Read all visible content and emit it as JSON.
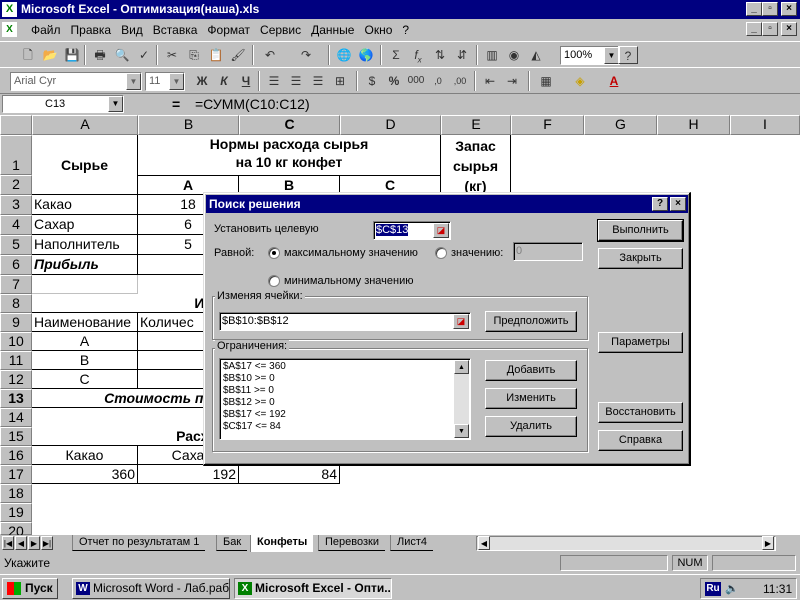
{
  "window": {
    "title": "Microsoft Excel - Оптимизация(наша).xls",
    "app_icon": "excel-icon"
  },
  "menu": [
    "Файл",
    "Правка",
    "Вид",
    "Вставка",
    "Формат",
    "Сервис",
    "Данные",
    "Окно",
    "?"
  ],
  "toolbar": {
    "zoom": "100%",
    "font_name": "Arial Cyr",
    "font_size": "11",
    "bold": "Ж",
    "italic": "К",
    "underline": "Ч",
    "percent": "%",
    "sigma": "Σ",
    "fx": "f",
    "fx_sub": "x"
  },
  "formula_bar": {
    "name_box": "C13",
    "equals": "=",
    "formula": "=СУММ(C10:C12)"
  },
  "columns": [
    "A",
    "B",
    "C",
    "D",
    "E",
    "F",
    "G",
    "H",
    "I"
  ],
  "rows": [
    "1",
    "2",
    "3",
    "4",
    "5",
    "6",
    "7",
    "8",
    "9",
    "10",
    "11",
    "12",
    "13",
    "14",
    "15",
    "16",
    "17",
    "18",
    "19",
    "20"
  ],
  "cells": {
    "a1": "Сырье",
    "b1_l1": "Нормы расхода сырья",
    "b1_l2": "на 10 кг конфет",
    "e1_l1": "Запас",
    "e1_l2": "сырья",
    "e1_l3": "(кг)",
    "b2": "A",
    "c2": "B",
    "d2": "C",
    "a3": "Какао",
    "b3": "18",
    "a4": "Сахар",
    "b4": "6",
    "a5": "Наполнитель",
    "b5": "5",
    "a6": "Прибыль",
    "b8": "Издел",
    "a9": "Наименование",
    "b9": "Количес",
    "a10": "A",
    "a11": "B",
    "a12": "C",
    "a13": "Стоимость проду",
    "b15": "Расход с",
    "a16": "Какао",
    "b16": "Саха",
    "a17": "360",
    "b17": "192",
    "c17": "84"
  },
  "sheet_tabs": [
    "Отчет по результатам 1",
    "Бак",
    "Конфеты",
    "Перевозки",
    "Лист4"
  ],
  "active_sheet": "Конфеты",
  "status": {
    "text": "Укажите",
    "num": "NUM"
  },
  "taskbar": {
    "start": "Пуск",
    "tasks": [
      {
        "label": "Microsoft Word - Лаб.раб...",
        "icon": "W",
        "active": false
      },
      {
        "label": "Microsoft Excel - Опти...",
        "icon": "X",
        "active": true
      }
    ],
    "lang": "Ru",
    "clock": "11:31"
  },
  "dialog": {
    "title": "Поиск решения",
    "help": "?",
    "target_label": "Установить целевую",
    "target_value": "$C$13",
    "equal_label": "Равной:",
    "opt_max": "максимальному значению",
    "opt_value": "значению:",
    "value_field": "0",
    "opt_min": "минимальному значению",
    "changing_label": "Изменяя ячейки:",
    "changing_value": "$B$10:$B$12",
    "constraints_label": "Ограничения:",
    "constraints": [
      "$A$17 <= 360",
      "$B$10 >= 0",
      "$B$11 >= 0",
      "$B$12 >= 0",
      "$B$17 <= 192",
      "$C$17 <= 84"
    ],
    "btn_guess": "Предположить",
    "btn_run": "Выполнить",
    "btn_close": "Закрыть",
    "btn_params": "Параметры",
    "btn_add": "Добавить",
    "btn_change": "Изменить",
    "btn_delete": "Удалить",
    "btn_reset": "Восстановить",
    "btn_help": "Справка",
    "selected_option": "max"
  }
}
